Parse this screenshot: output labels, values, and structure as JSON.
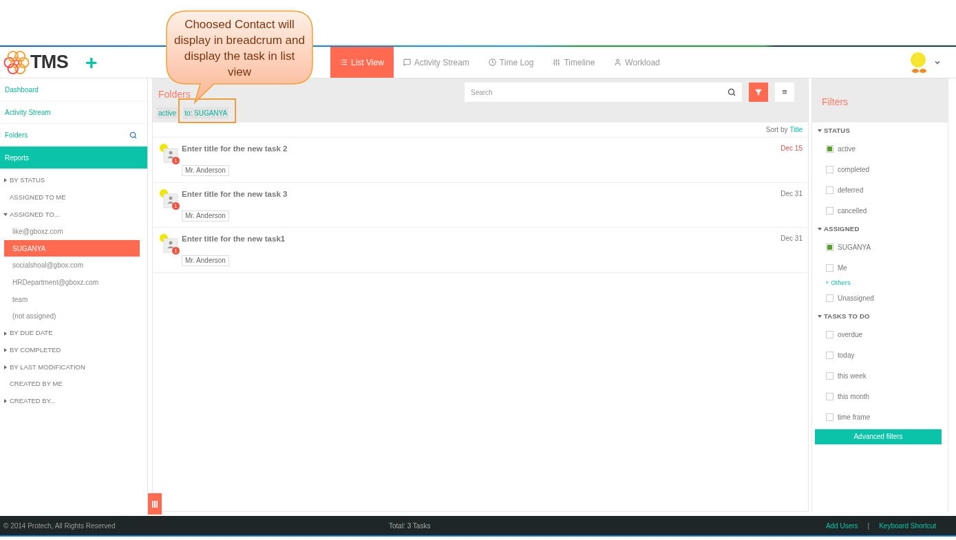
{
  "callout": {
    "text": "Choosed Contact will display in breadcrum and display the task in list view"
  },
  "header": {
    "logo": "TMS",
    "add": "+",
    "tabs": [
      {
        "label": "List View",
        "selected": true
      },
      {
        "label": "Activity Stream",
        "selected": false
      },
      {
        "label": "Time Log",
        "selected": false
      },
      {
        "label": "Timeline",
        "selected": false
      },
      {
        "label": "Workload",
        "selected": false
      }
    ]
  },
  "sidebar": {
    "nav": [
      {
        "label": "Dashboard",
        "kind": "link",
        "selected": false
      },
      {
        "label": "Activity Stream",
        "kind": "link",
        "selected": false
      },
      {
        "label": "Folders",
        "kind": "search",
        "selected": false
      },
      {
        "label": "Reports",
        "kind": "link",
        "selected": true
      }
    ],
    "report_tree": [
      {
        "label": "BY STATUS",
        "kind": "group",
        "expanded": false
      },
      {
        "label": "ASSIGNED TO ME",
        "kind": "leaf"
      },
      {
        "label": "ASSIGNED TO...",
        "kind": "group",
        "expanded": true,
        "children": [
          {
            "label": "like@gboxz.com",
            "selected": false
          },
          {
            "label": "SUGANYA",
            "selected": true
          },
          {
            "label": "socialshoal@gbox.com",
            "selected": false
          },
          {
            "label": "HRDepartment@gboxz.com",
            "selected": false
          },
          {
            "label": "team",
            "selected": false
          },
          {
            "label": "(not assigned)",
            "selected": false
          }
        ]
      },
      {
        "label": "BY DUE DATE",
        "kind": "group",
        "expanded": false
      },
      {
        "label": "BY COMPLETED",
        "kind": "group",
        "expanded": false
      },
      {
        "label": "BY LAST MODIFICATION",
        "kind": "group",
        "expanded": false
      },
      {
        "label": "CREATED BY ME",
        "kind": "leaf"
      },
      {
        "label": "CREATED BY...",
        "kind": "group",
        "expanded": false
      }
    ]
  },
  "main": {
    "title": "Folders",
    "search": {
      "placeholder": "Search"
    },
    "menu_glyph": "≡",
    "breadcrumbs": [
      "active",
      "to: SUGANYA"
    ],
    "sort": {
      "label": "Sort by",
      "value": "Title"
    },
    "tasks": [
      {
        "title": "Enter title for the new task 2",
        "badge": "1",
        "assignee": "Mr. Anderson",
        "due": "Dec 15",
        "overdue": true
      },
      {
        "title": "Enter title for the new task 3",
        "badge": "1",
        "assignee": "Mr. Anderson",
        "due": "Dec 31",
        "overdue": false
      },
      {
        "title": "Enter title for the new task1",
        "badge": "1",
        "assignee": "Mr. Anderson",
        "due": "Dec 31",
        "overdue": false
      }
    ]
  },
  "filters": {
    "title": "Filters",
    "sections": [
      {
        "title": "STATUS",
        "expanded": true,
        "options": [
          {
            "label": "active",
            "kind": "checkbox",
            "checked": true
          },
          {
            "label": "completed",
            "kind": "checkbox",
            "checked": false
          },
          {
            "label": "deferred",
            "kind": "checkbox",
            "checked": false
          },
          {
            "label": "cancelled",
            "kind": "checkbox",
            "checked": false
          }
        ]
      },
      {
        "title": "ASSIGNED",
        "expanded": true,
        "options": [
          {
            "label": "SUGANYA",
            "kind": "checkbox",
            "checked": true
          },
          {
            "label": "Me",
            "kind": "checkbox",
            "checked": false
          },
          {
            "label": "+ Others",
            "kind": "link"
          },
          {
            "label": "Unassigned",
            "kind": "checkbox",
            "checked": false
          }
        ]
      },
      {
        "title": "TASKS TO DO",
        "expanded": true,
        "options": [
          {
            "label": "overdue",
            "kind": "checkbox",
            "checked": false
          },
          {
            "label": "today",
            "kind": "checkbox",
            "checked": false
          },
          {
            "label": "this week",
            "kind": "checkbox",
            "checked": false
          },
          {
            "label": "this month",
            "kind": "checkbox",
            "checked": false
          },
          {
            "label": "time frame",
            "kind": "checkbox",
            "checked": false
          }
        ]
      }
    ],
    "advanced": "Advanced filters"
  },
  "footer": {
    "copyright": "© 2014 Protech, All Rights Reserved",
    "total": "Total: 3 Tasks",
    "links": [
      "Add Users",
      "Keyboard Shortcut"
    ],
    "separator": "|"
  }
}
